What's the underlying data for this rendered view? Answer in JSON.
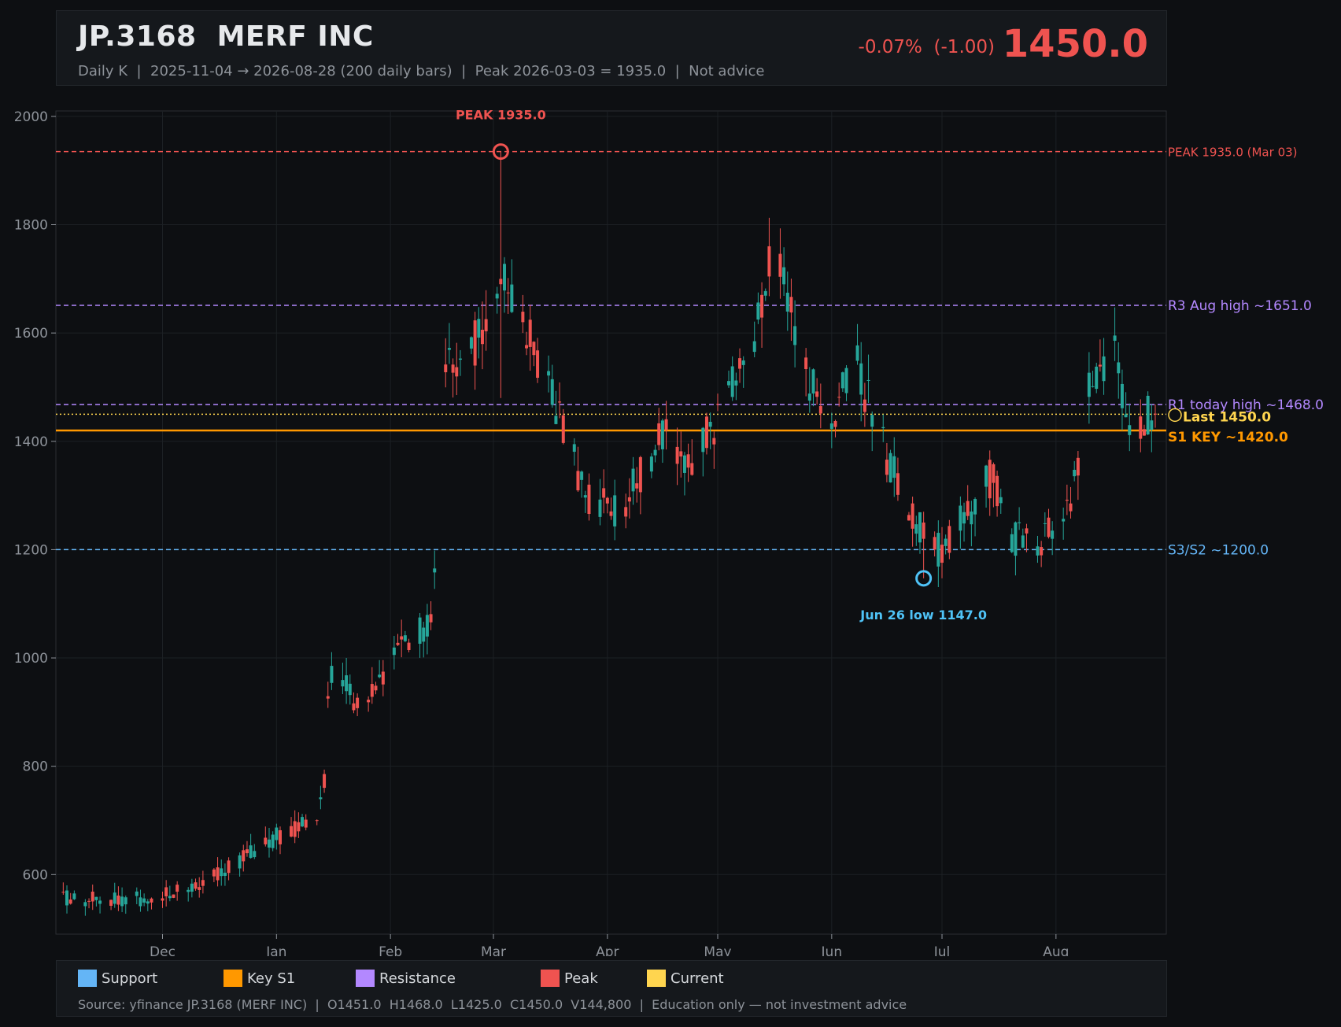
{
  "header": {
    "title": "JP.3168  MERF INC",
    "subtitle": "Daily K  |  2025-11-04 → 2026-08-28 (200 daily bars)  |  Peak 2026-03-03 = 1935.0  |  Not advice",
    "change": "-0.07%  (-1.00)",
    "price": "1450.0"
  },
  "legend": {
    "items": [
      {
        "label": "Support",
        "color": "#64b5f6"
      },
      {
        "label": "Key S1",
        "color": "#ff9800"
      },
      {
        "label": "Resistance",
        "color": "#b388ff"
      },
      {
        "label": "Peak",
        "color": "#ef5350"
      },
      {
        "label": "Current",
        "color": "#ffd54f"
      }
    ],
    "source": "Source: yfinance JP.3168 (MERF INC)  |  O1451.0  H1468.0  L1425.0  C1450.0  V144,800  |  Education only — not investment advice"
  },
  "chart_data": {
    "type": "candlestick",
    "ylim": [
      490,
      2010
    ],
    "y_ticks": [
      600,
      800,
      1000,
      1200,
      1400,
      1600,
      1800,
      2000
    ],
    "x_ticks": [
      {
        "label": "Dec",
        "date": "2025-12-01"
      },
      {
        "label": "Jan",
        "date": "2026-01-01"
      },
      {
        "label": "Feb",
        "date": "2026-02-01"
      },
      {
        "label": "Mar",
        "date": "2026-03-01"
      },
      {
        "label": "Apr",
        "date": "2026-04-01"
      },
      {
        "label": "May",
        "date": "2026-05-01"
      },
      {
        "label": "Jun",
        "date": "2026-06-01"
      },
      {
        "label": "Jul",
        "date": "2026-07-01"
      },
      {
        "label": "Aug",
        "date": "2026-08-01"
      }
    ],
    "x_range": [
      "2025-11-02",
      "2026-08-31"
    ],
    "grid": true,
    "colors": {
      "up": "#26a69a",
      "down": "#ef5350"
    },
    "levels": [
      {
        "value": 1935.0,
        "label": "PEAK 1935.0 (Mar 03)",
        "color": "#ef5350",
        "style": "dashed"
      },
      {
        "value": 1651.0,
        "label": "R3 Aug high ~1651.0",
        "color": "#b388ff",
        "style": "dashed"
      },
      {
        "value": 1468.0,
        "label": "R1 today high ~1468.0",
        "color": "#b388ff",
        "style": "dashed"
      },
      {
        "value": 1450.0,
        "label": "Last 1450.0",
        "color": "#ffd54f",
        "style": "dotted"
      },
      {
        "value": 1420.0,
        "label": "S1 KEY ~1420.0",
        "color": "#ff9800",
        "style": "solid"
      },
      {
        "value": 1200.0,
        "label": "S3/S2 ~1200.0",
        "color": "#64b5f6",
        "style": "dashed"
      }
    ],
    "annotations": [
      {
        "date": "2026-03-03",
        "value": 1935.0,
        "text": "PEAK 1935.0",
        "color": "#ef5350"
      },
      {
        "date": "2026-06-26",
        "value": 1147.0,
        "text": "Jun 26 low 1147.0",
        "color": "#4fc3f7"
      }
    ],
    "anchors": [
      [
        "2025-11-04",
        555
      ],
      [
        "2025-11-25",
        556
      ],
      [
        "2025-12-10",
        575
      ],
      [
        "2025-12-20",
        615
      ],
      [
        "2026-01-01",
        670
      ],
      [
        "2026-01-12",
        700
      ],
      [
        "2026-01-14",
        770
      ],
      [
        "2026-01-15",
        925
      ],
      [
        "2026-01-17",
        1000
      ],
      [
        "2026-01-24",
        900
      ],
      [
        "2026-02-01",
        1000
      ],
      [
        "2026-02-12",
        1070
      ],
      [
        "2026-02-14",
        1300
      ],
      [
        "2026-02-16",
        1560
      ],
      [
        "2026-02-23",
        1560
      ],
      [
        "2026-03-03",
        1720
      ],
      [
        "2026-03-10",
        1600
      ],
      [
        "2026-03-17",
        1480
      ],
      [
        "2026-03-26",
        1300
      ],
      [
        "2026-04-04",
        1270
      ],
      [
        "2026-04-09",
        1330
      ],
      [
        "2026-04-16",
        1420
      ],
      [
        "2026-04-22",
        1350
      ],
      [
        "2026-05-02",
        1450
      ],
      [
        "2026-05-10",
        1580
      ],
      [
        "2026-05-16",
        1750
      ],
      [
        "2026-05-24",
        1550
      ],
      [
        "2026-06-01",
        1420
      ],
      [
        "2026-06-07",
        1560
      ],
      [
        "2026-06-12",
        1450
      ],
      [
        "2026-06-18",
        1340
      ],
      [
        "2026-06-26",
        1220
      ],
      [
        "2026-06-30",
        1200
      ],
      [
        "2026-07-07",
        1260
      ],
      [
        "2026-07-15",
        1340
      ],
      [
        "2026-07-20",
        1220
      ],
      [
        "2026-07-28",
        1220
      ],
      [
        "2026-08-05",
        1280
      ],
      [
        "2026-08-10",
        1490
      ],
      [
        "2026-08-17",
        1560
      ],
      [
        "2026-08-20",
        1440
      ],
      [
        "2026-08-28",
        1450
      ]
    ],
    "ohlc": [
      {
        "date": "2026-03-03",
        "open": 1700.0,
        "high": 1935.0,
        "low": 1480.0,
        "close": 1690.0
      },
      {
        "date": "2026-06-26",
        "open": 1250.0,
        "high": 1270.0,
        "low": 1147.0,
        "close": 1220.0
      },
      {
        "date": "2026-08-28",
        "open": 1451.0,
        "high": 1468.0,
        "low": 1425.0,
        "close": 1450.0
      }
    ]
  }
}
